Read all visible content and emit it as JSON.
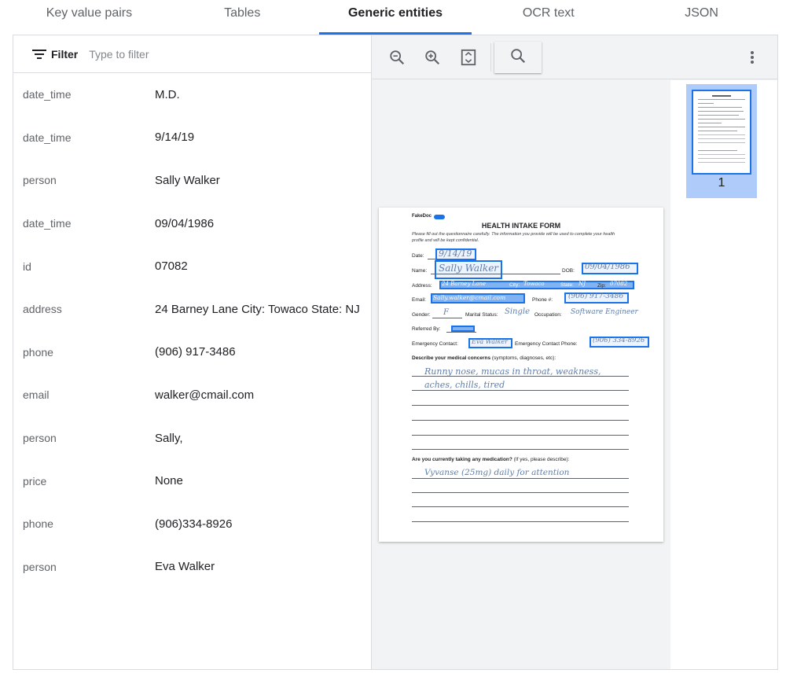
{
  "tabs": [
    {
      "label": "Key value pairs",
      "active": false
    },
    {
      "label": "Tables",
      "active": false
    },
    {
      "label": "Generic entities",
      "active": true
    },
    {
      "label": "OCR text",
      "active": false
    },
    {
      "label": "JSON",
      "active": false
    }
  ],
  "filter": {
    "label": "Filter",
    "placeholder": "Type to filter"
  },
  "entities": [
    {
      "type": "date_time",
      "value": "M.D."
    },
    {
      "type": "date_time",
      "value": "9/14/19"
    },
    {
      "type": "person",
      "value": "Sally Walker"
    },
    {
      "type": "date_time",
      "value": "09/04/1986"
    },
    {
      "type": "id",
      "value": "07082"
    },
    {
      "type": "address",
      "value": "24 Barney Lane City: Towaco State: NJ"
    },
    {
      "type": "phone",
      "value": "(906) 917-3486"
    },
    {
      "type": "email",
      "value": "walker@cmail.com"
    },
    {
      "type": "person",
      "value": "Sally,"
    },
    {
      "type": "price",
      "value": "None"
    },
    {
      "type": "phone",
      "value": "(906)334-8926"
    },
    {
      "type": "person",
      "value": "Eva Walker"
    }
  ],
  "toolbar": {
    "icons": [
      "zoom-out-icon",
      "zoom-in-icon",
      "fit-page-icon",
      "search-icon",
      "more-vert-icon"
    ]
  },
  "thumbnail": {
    "page_number": "1"
  },
  "document": {
    "brand": "FakeDoc",
    "title": "HEALTH INTAKE FORM",
    "instructions": "Please fill out the questionnaire carefully. The information you provide will be used to complete your health profile and will be kept confidential.",
    "labels": {
      "date": "Date:",
      "name": "Name:",
      "dob": "DOB:",
      "address": "Address:",
      "city": "City:",
      "state": "State:",
      "zip": "Zip:",
      "email": "Email:",
      "phone": "Phone #:",
      "gender": "Gender:",
      "marital": "Marital Status:",
      "occupation": "Occupation:",
      "referred": "Referred By:",
      "emergency": "Emergency Contact:",
      "emergency_phone": "Emergency Contact Phone:",
      "concerns_bold": "Describe your medical concerns",
      "concerns_rest": " (symptoms, diagnoses, etc):",
      "meds_bold": "Are you currently taking any medication?",
      "meds_rest": " (If yes, please describe):"
    },
    "handwriting": {
      "date": "9/14/19",
      "name": "Sally Walker",
      "dob": "09/04/1986",
      "address": "24 Barney Lane",
      "city": "Towaco",
      "state": "NJ",
      "zip": "07082",
      "email": "Sally.walker@cmail.com",
      "phone": "(906) 917-3486",
      "gender": "F",
      "marital": "Single",
      "occupation": "Software Engineer",
      "emergency": "Eva Walker",
      "emergency_phone": "(906) 334-8926",
      "concerns_1": "Runny nose, mucas in throat, weakness,",
      "concerns_2": "aches, chills, tired",
      "meds_1": "Vyvanse (25mg) daily for attention"
    }
  }
}
